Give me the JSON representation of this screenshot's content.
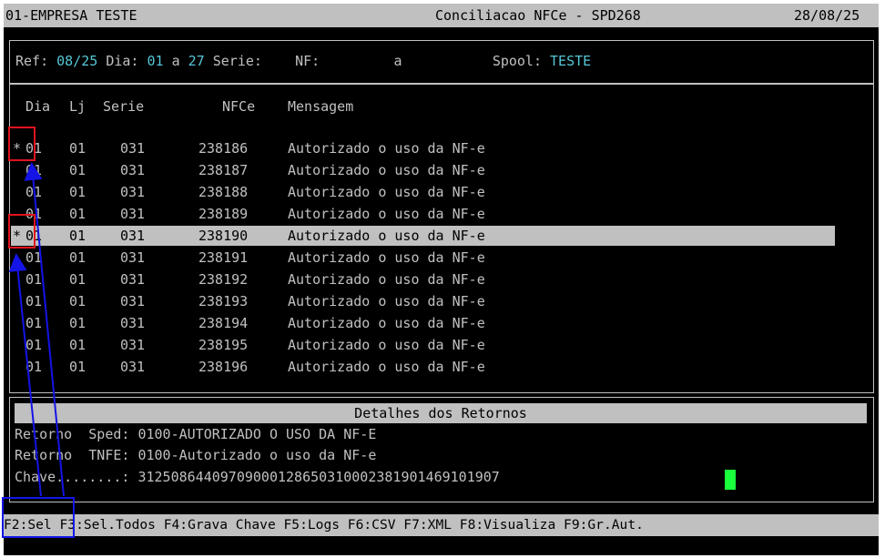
{
  "title": {
    "company": "01-EMPRESA TESTE",
    "program": "Conciliacao NFCe - SPD268",
    "date": "28/08/25"
  },
  "filters": {
    "ref_label": "Ref:",
    "ref_value": "08/25",
    "dia_label": "Dia:",
    "dia_from": "01",
    "dia_sep": "a",
    "dia_to": "27",
    "serie_label": "Serie:",
    "nf_label": "NF:",
    "nf_sep": "a",
    "spool_label": "Spool:",
    "spool_value": "TESTE"
  },
  "columns": [
    "Dia",
    "Lj",
    "Serie",
    "NFCe",
    "Mensagem"
  ],
  "rows": [
    {
      "mark": "*",
      "dia": "01",
      "lj": "01",
      "serie": "031",
      "nfce": "238186",
      "msg": "Autorizado o uso da NF-e"
    },
    {
      "mark": "",
      "dia": "01",
      "lj": "01",
      "serie": "031",
      "nfce": "238187",
      "msg": "Autorizado o uso da NF-e"
    },
    {
      "mark": "",
      "dia": "01",
      "lj": "01",
      "serie": "031",
      "nfce": "238188",
      "msg": "Autorizado o uso da NF-e"
    },
    {
      "mark": "",
      "dia": "01",
      "lj": "01",
      "serie": "031",
      "nfce": "238189",
      "msg": "Autorizado o uso da NF-e"
    },
    {
      "mark": "*",
      "dia": "01",
      "lj": "01",
      "serie": "031",
      "nfce": "238190",
      "msg": "Autorizado o uso da NF-e"
    },
    {
      "mark": "",
      "dia": "01",
      "lj": "01",
      "serie": "031",
      "nfce": "238191",
      "msg": "Autorizado o uso da NF-e"
    },
    {
      "mark": "",
      "dia": "01",
      "lj": "01",
      "serie": "031",
      "nfce": "238192",
      "msg": "Autorizado o uso da NF-e"
    },
    {
      "mark": "",
      "dia": "01",
      "lj": "01",
      "serie": "031",
      "nfce": "238193",
      "msg": "Autorizado o uso da NF-e"
    },
    {
      "mark": "",
      "dia": "01",
      "lj": "01",
      "serie": "031",
      "nfce": "238194",
      "msg": "Autorizado o uso da NF-e"
    },
    {
      "mark": "",
      "dia": "01",
      "lj": "01",
      "serie": "031",
      "nfce": "238195",
      "msg": "Autorizado o uso da NF-e"
    },
    {
      "mark": "",
      "dia": "01",
      "lj": "01",
      "serie": "031",
      "nfce": "238196",
      "msg": "Autorizado o uso da NF-e"
    }
  ],
  "details": {
    "header": "Detalhes dos Retornos",
    "line1": "Retorno  Sped: 0100-AUTORIZADO O USO DA NF-E",
    "line2": "Retorno  TNFE: 0100-Autorizado o uso da NF-e",
    "line3": "Chave........: 31250864409709000128650310002381901469101907"
  },
  "function_keys": "F2:Sel F3:Sel.Todos F4:Grava Chave F5:Logs F6:CSV F7:XML F8:Visualiza F9:Gr.Aut.",
  "colors": {
    "background": "#000000",
    "text": "#c0c0c0",
    "value": "#55c7d6",
    "highlight": "#c0c0c0",
    "cursor": "#19ff3c",
    "annotation_red": "#e0141e",
    "annotation_blue": "#1414e6"
  }
}
